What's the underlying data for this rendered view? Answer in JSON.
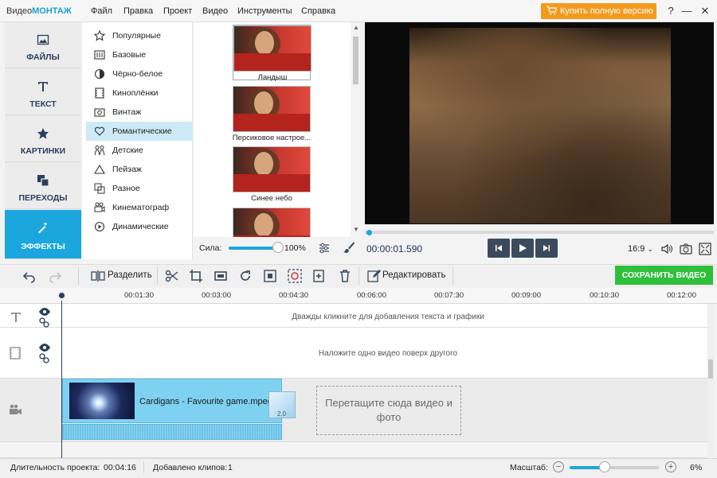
{
  "app": {
    "logo_prefix": "Видео",
    "logo_brand": "МОНТАЖ"
  },
  "menu": [
    "Файл",
    "Правка",
    "Проект",
    "Видео",
    "Инструменты",
    "Справка"
  ],
  "buy_button": "Купить полную версию",
  "window_controls": [
    "?",
    "—",
    "☐",
    "✕"
  ],
  "leftnav": {
    "items": [
      {
        "label": "ФАЙЛЫ",
        "icon": "image-icon"
      },
      {
        "label": "ТЕКСТ",
        "icon": "text-icon"
      },
      {
        "label": "КАРТИНКИ",
        "icon": "star-icon"
      },
      {
        "label": "ПЕРЕХОДЫ",
        "icon": "transitions-icon"
      },
      {
        "label": "ЭФФЕКТЫ",
        "icon": "magic-wand-icon",
        "active": true
      }
    ]
  },
  "effects": {
    "items": [
      {
        "label": "Популярные",
        "icon": "star-outline-icon"
      },
      {
        "label": "Базовые",
        "icon": "sliders-icon"
      },
      {
        "label": "Чёрно-белое",
        "icon": "contrast-icon"
      },
      {
        "label": "Киноплёнки",
        "icon": "film-icon"
      },
      {
        "label": "Винтаж",
        "icon": "camera-icon"
      },
      {
        "label": "Романтические",
        "icon": "heart-icon",
        "active": true
      },
      {
        "label": "Детские",
        "icon": "kids-icon"
      },
      {
        "label": "Пейзаж",
        "icon": "mountain-icon"
      },
      {
        "label": "Разное",
        "icon": "misc-icon"
      },
      {
        "label": "Кинематограф",
        "icon": "movie-camera-icon"
      },
      {
        "label": "Динамические",
        "icon": "play-circle-icon"
      }
    ],
    "presets": [
      {
        "caption": "Ландыш",
        "selected": true
      },
      {
        "caption": "Персиковое настрое..."
      },
      {
        "caption": "Синее небо"
      },
      {
        "caption": ""
      }
    ],
    "strength_label": "Сила:",
    "strength_value": "100%",
    "strength_fraction": 1.0
  },
  "player": {
    "timecode": "00:00:01.590",
    "aspect": "16:9",
    "progress_fraction": 0.01
  },
  "toolbar": {
    "split_label": "Разделить",
    "edit_label": "Редактировать",
    "save_label": "СОХРАНИТЬ ВИДЕО"
  },
  "timeline": {
    "ticks": [
      "00:01:30",
      "00:03:00",
      "00:04:30",
      "00:06:00",
      "00:07:30",
      "00:09:00",
      "00:10:30",
      "00:12:00"
    ],
    "text_hint": "Дважды кликните для добавления текста и графики",
    "overlay_hint": "Наложите одно видео поверх другого",
    "clip_name": "Cardigans - Favourite game.mpeg",
    "transition_duration": "2.0",
    "drop_zone": "Перетащите сюда видео и фото"
  },
  "status": {
    "duration_label": "Длительность проекта:",
    "duration_value": "00:04:16",
    "clips_label": "Добавлено клипов:",
    "clips_value": "1",
    "zoom_label": "Масштаб:",
    "zoom_value": "6%",
    "zoom_fraction": 0.06
  },
  "colors": {
    "accent": "#1ba7dd",
    "buy": "#f39a1e",
    "save": "#2fbf3a",
    "nav_text": "#2b3f5a"
  }
}
